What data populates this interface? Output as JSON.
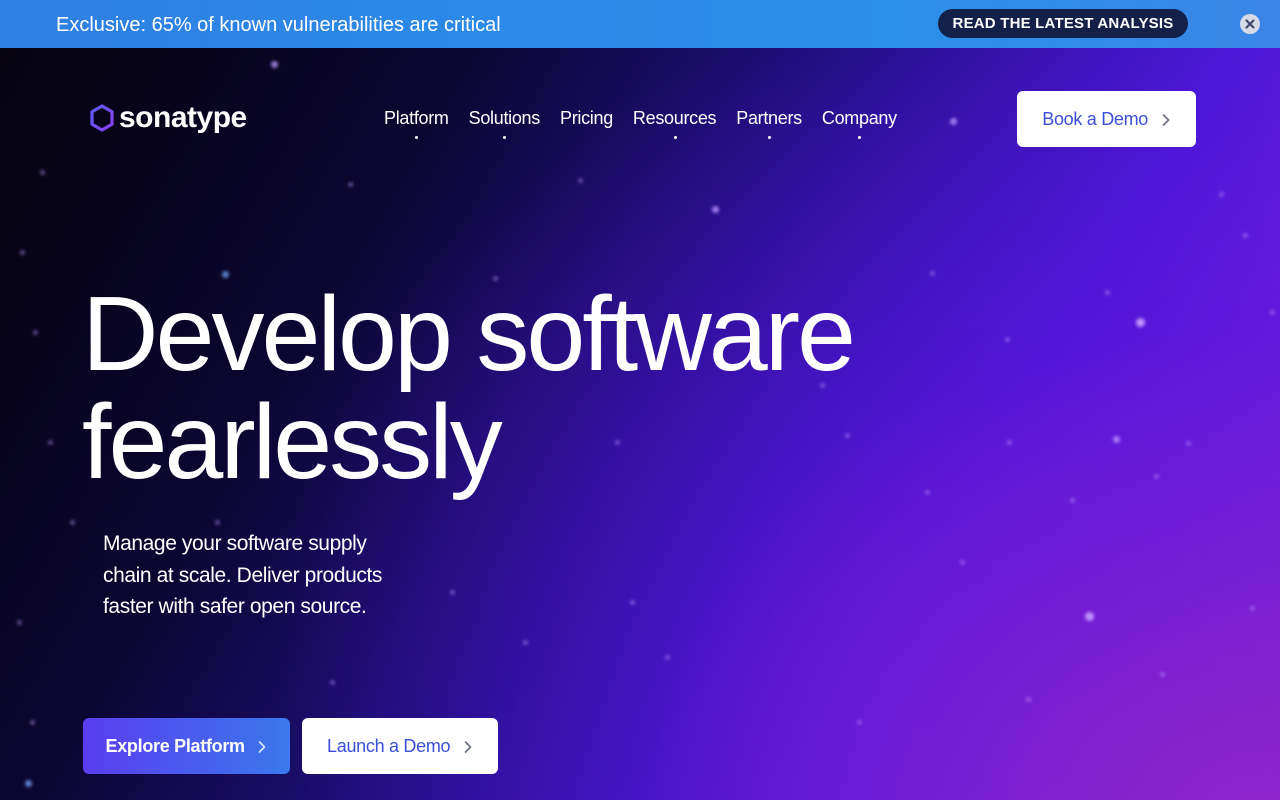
{
  "announcement": {
    "text": "Exclusive: 65% of known vulnerabilities are critical",
    "cta_label": "READ THE LATEST ANALYSIS",
    "close_icon": "close-icon"
  },
  "header": {
    "logo_text": "sonatype",
    "logo_icon": "hexagon-logo-icon",
    "nav": [
      {
        "label": "Platform",
        "has_menu": true
      },
      {
        "label": "Solutions",
        "has_menu": true
      },
      {
        "label": "Pricing",
        "has_menu": false
      },
      {
        "label": "Resources",
        "has_menu": true
      },
      {
        "label": "Partners",
        "has_menu": true
      },
      {
        "label": "Company",
        "has_menu": true
      }
    ],
    "cta_label": "Book a Demo"
  },
  "hero": {
    "title_line1": "Develop software",
    "title_line2": "fearlessly",
    "subtitle": "Manage your software supply chain at scale. Deliver products faster with safer open source.",
    "primary_label": "Explore Platform",
    "secondary_label": "Launch a Demo"
  },
  "colors": {
    "accent_blue": "#3b4fd8",
    "announce_bg": "#2b8ae8",
    "announce_cta_bg": "#12204a",
    "logo_purple": "#7b3ff2"
  }
}
